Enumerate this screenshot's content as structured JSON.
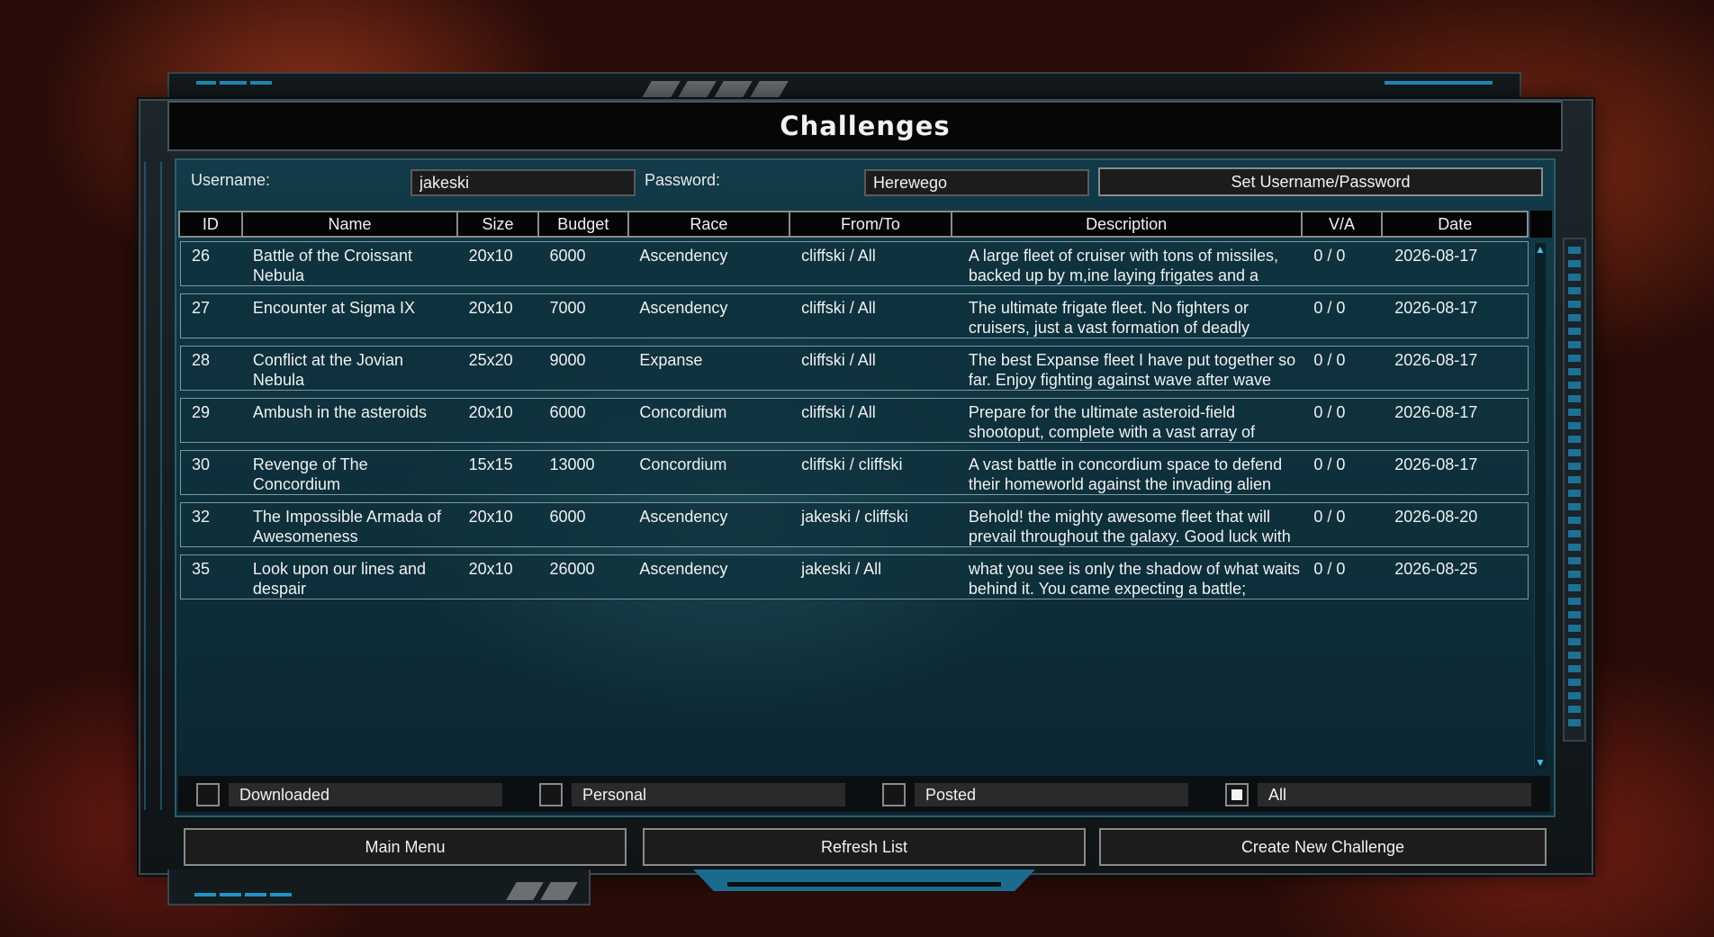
{
  "title": "Challenges",
  "credentials": {
    "username_label": "Username:",
    "username_value": "jakeski",
    "password_label": "Password:",
    "password_value": "Herewego",
    "set_button": "Set Username/Password"
  },
  "table": {
    "columns": [
      "ID",
      "Name",
      "Size",
      "Budget",
      "Race",
      "From/To",
      "Description",
      "V/A",
      "Date"
    ],
    "rows": [
      {
        "id": "26",
        "name": "Battle of the Croissant Nebula",
        "size": "20x10",
        "budget": "6000",
        "race": "Ascendency",
        "from_to": "cliffski / All",
        "description": "A large fleet of cruiser with tons of missiles, backed up by m,ine laying frigates and a",
        "va": "0 / 0",
        "date": "2026-08-17"
      },
      {
        "id": "27",
        "name": "Encounter at Sigma IX",
        "size": "20x10",
        "budget": "7000",
        "race": "Ascendency",
        "from_to": "cliffski / All",
        "description": "The ultimate frigate fleet. No fighters or cruisers, just a vast formation of deadly",
        "va": "0 / 0",
        "date": "2026-08-17"
      },
      {
        "id": "28",
        "name": "Conflict at the Jovian Nebula",
        "size": "25x20",
        "budget": "9000",
        "race": "Expanse",
        "from_to": "cliffski / All",
        "description": "The best Expanse fleet I have put together so far. Enjoy fighting against wave after wave",
        "va": "0 / 0",
        "date": "2026-08-17"
      },
      {
        "id": "29",
        "name": "Ambush in the asteroids",
        "size": "20x10",
        "budget": "6000",
        "race": "Concordium",
        "from_to": "cliffski / All",
        "description": "Prepare for the ultimate asteroid-field shootoput, complete with a vast array of",
        "va": "0 / 0",
        "date": "2026-08-17"
      },
      {
        "id": "30",
        "name": "Revenge of The Concordium",
        "size": "15x15",
        "budget": "13000",
        "race": "Concordium",
        "from_to": "cliffski / cliffski",
        "description": "A vast battle in concordium space to defend their homeworld against the invading alien",
        "va": "0 / 0",
        "date": "2026-08-17"
      },
      {
        "id": "32",
        "name": "The Impossible Armada of Awesomeness",
        "size": "20x10",
        "budget": "6000",
        "race": "Ascendency",
        "from_to": "jakeski / cliffski",
        "description": "Behold! the mighty awesome fleet that will prevail throughout the galaxy. Good luck with",
        "va": "0 / 0",
        "date": "2026-08-20"
      },
      {
        "id": "35",
        "name": "Look upon our lines and despair",
        "size": "20x10",
        "budget": "26000",
        "race": "Ascendency",
        "from_to": "jakeski / All",
        "description": "what you see is only the shadow of what waits behind it. You came expecting a battle;",
        "va": "0 / 0",
        "date": "2026-08-25"
      }
    ]
  },
  "scroll": {
    "up_icon": "▲",
    "down_icon": "▼"
  },
  "filters": [
    {
      "label": "Downloaded",
      "checked": false
    },
    {
      "label": "Personal",
      "checked": false
    },
    {
      "label": "Posted",
      "checked": false
    },
    {
      "label": "All",
      "checked": true
    }
  ],
  "buttons": {
    "main_menu": "Main Menu",
    "refresh": "Refresh List",
    "create": "Create New Challenge"
  },
  "colors": {
    "accent": "#1f93c4",
    "panel": "#0e2f3a"
  }
}
